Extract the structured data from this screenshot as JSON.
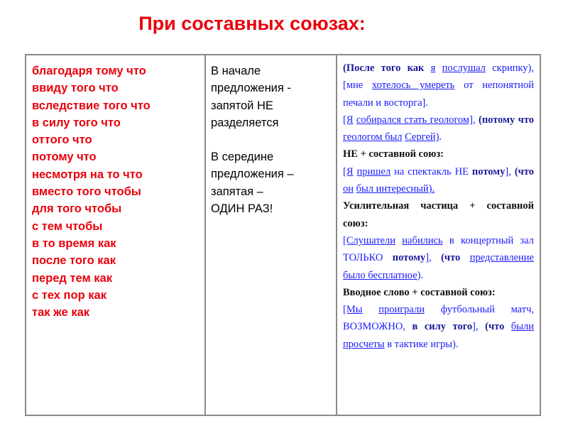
{
  "title": "При составных союзах:",
  "col1": [
    "благодаря тому что",
    "ввиду того что",
    "вследствие того что",
    "в силу того что",
    "оттого что",
    "потому что",
    "несмотря на то что",
    "вместо того чтобы",
    "для того чтобы",
    "с тем чтобы",
    "в то время как",
    "после того как",
    "перед тем как",
    "с тех пор как",
    "так же как"
  ],
  "col2": {
    "start": [
      "В начале",
      "предложения -",
      "запятой НЕ",
      "разделяется"
    ],
    "middle": [
      "В середине",
      "предложения –",
      "запятая –",
      "ОДИН РАЗ!"
    ]
  },
  "col3": [
    [
      {
        "t": "(После того как",
        "b": 1
      },
      {
        "t": " "
      },
      {
        "t": "я",
        "u": 1
      },
      {
        "t": " "
      },
      {
        "t": "послушал",
        "u": 1
      },
      {
        "t": " скрипку), [мне "
      },
      {
        "t": "хотелось умереть",
        "u": 1
      },
      {
        "t": " от непонятной печали и восторга]."
      }
    ],
    [
      {
        "t": "[Я",
        "u": 1
      },
      {
        "t": " "
      },
      {
        "t": "собирался стать геологом]",
        "u": 1
      },
      {
        "t": ", "
      },
      {
        "t": "(потому что",
        "b": 1
      },
      {
        "t": " "
      },
      {
        "t": "геологом был",
        "u": 1
      },
      {
        "t": " "
      },
      {
        "t": "Сергей)",
        "u": 1
      },
      {
        "t": "."
      }
    ],
    [
      {
        "t": "НЕ + составной союз:",
        "h": 1
      }
    ],
    [
      {
        "t": "[Я",
        "u": 1
      },
      {
        "t": " "
      },
      {
        "t": "пришел",
        "u": 1
      },
      {
        "t": " на спектакль НЕ "
      },
      {
        "t": "потому",
        "b": 1
      },
      {
        "t": "], "
      },
      {
        "t": "(что",
        "b": 1
      },
      {
        "t": " "
      },
      {
        "t": "он",
        "u": 1
      },
      {
        "t": " "
      },
      {
        "t": "был интересный).",
        "u": 1
      }
    ],
    [
      {
        "t": "Усилительная частица + составной союз:",
        "h": 1
      }
    ],
    [
      {
        "t": "[Слушатели",
        "u": 1
      },
      {
        "t": " "
      },
      {
        "t": "набились",
        "u": 1
      },
      {
        "t": " в концертный зал ТОЛЬКО "
      },
      {
        "t": "потому",
        "b": 1
      },
      {
        "t": "], "
      },
      {
        "t": "(что",
        "b": 1
      },
      {
        "t": " "
      },
      {
        "t": "представление",
        "u": 1
      },
      {
        "t": " "
      },
      {
        "t": "было бесплатное",
        "u": 1
      },
      {
        "t": ")."
      }
    ],
    [
      {
        "t": "Вводное слово + составной союз:",
        "h": 1
      }
    ],
    [
      {
        "t": "[Мы",
        "u": 1
      },
      {
        "t": " "
      },
      {
        "t": "проиграли",
        "u": 1
      },
      {
        "t": " футбольный матч, ВОЗМОЖНО, "
      },
      {
        "t": "в силу того",
        "b": 1
      },
      {
        "t": "], "
      },
      {
        "t": "(что",
        "b": 1
      },
      {
        "t": " "
      },
      {
        "t": "были",
        "u": 1
      },
      {
        "t": " "
      },
      {
        "t": "просчеты",
        "u": 1
      },
      {
        "t": " в тактике игры)."
      }
    ]
  ]
}
